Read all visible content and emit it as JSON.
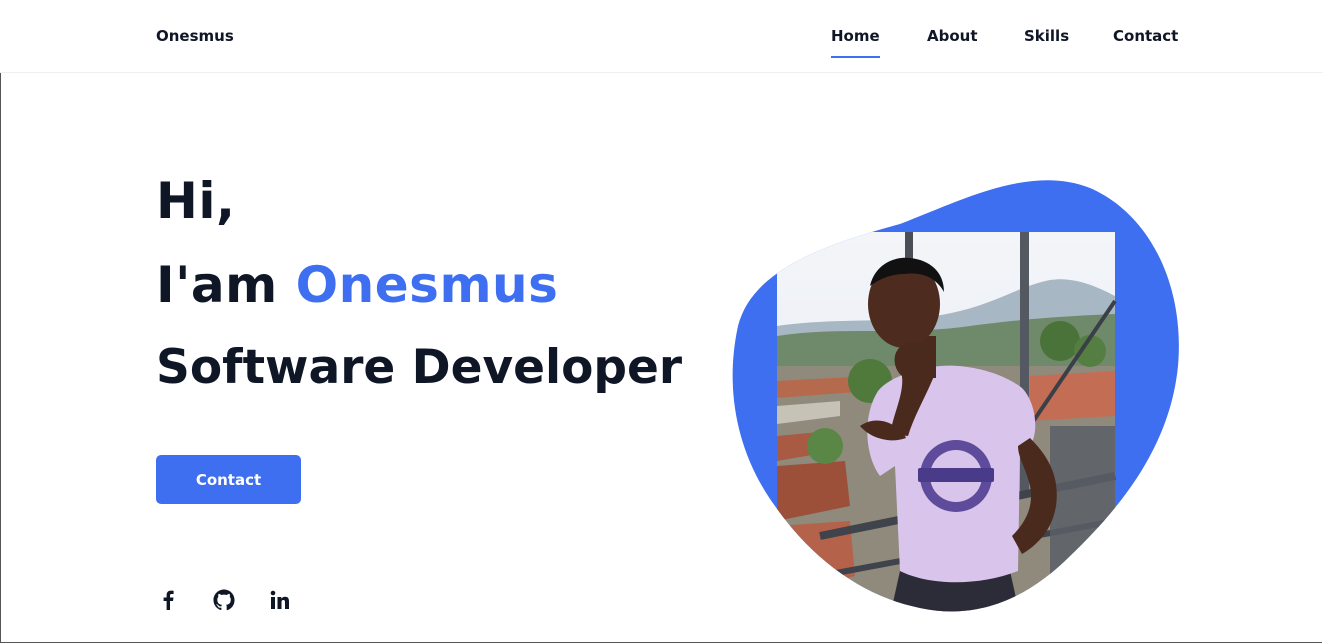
{
  "header": {
    "logo": "Onesmus",
    "nav": [
      {
        "label": "Home",
        "active": true
      },
      {
        "label": "About",
        "active": false
      },
      {
        "label": "Skills",
        "active": false
      },
      {
        "label": "Contact",
        "active": false
      }
    ]
  },
  "hero": {
    "greeting": "Hi,",
    "intro_prefix": "I'am ",
    "name": "Onesmus",
    "title": "Software Developer",
    "cta_label": "Contact"
  },
  "social": [
    {
      "icon": "facebook-icon"
    },
    {
      "icon": "github-icon"
    },
    {
      "icon": "linkedin-icon"
    }
  ],
  "colors": {
    "accent": "#3e6ff0",
    "text": "#0f1626",
    "shirt": "#d9c4ec",
    "sky": "#eef1f6"
  }
}
